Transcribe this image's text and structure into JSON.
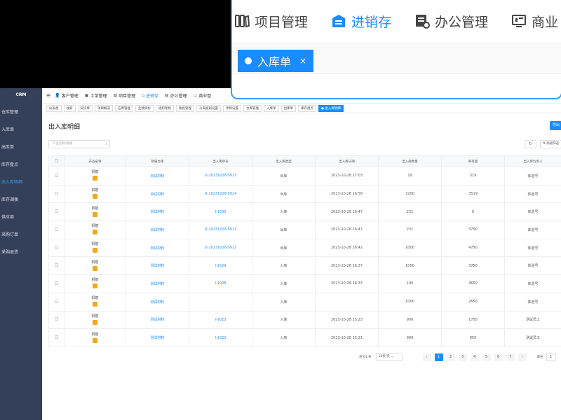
{
  "sidebar": {
    "logo": "CRM",
    "items": [
      {
        "label": "仓库管理"
      },
      {
        "label": "入库单"
      },
      {
        "label": "出库单"
      },
      {
        "label": "库存盘点"
      },
      {
        "label": "出入库明细"
      },
      {
        "label": "库存调拨"
      },
      {
        "label": "供应商"
      },
      {
        "label": "采购订单"
      },
      {
        "label": "采购退货"
      }
    ]
  },
  "navbar": {
    "items": [
      {
        "label": "客户管理"
      },
      {
        "label": "工单管理"
      },
      {
        "label": "项目管理"
      },
      {
        "label": "进销存"
      },
      {
        "label": "办公管理"
      },
      {
        "label": "商业智"
      }
    ]
  },
  "tags": [
    {
      "label": "仪表盘"
    },
    {
      "label": "线索"
    },
    {
      "label": "知识库"
    },
    {
      "label": "项目概况"
    },
    {
      "label": "应用管理"
    },
    {
      "label": "业绩目标"
    },
    {
      "label": "组织架构"
    },
    {
      "label": "角色管理"
    },
    {
      "label": "公海规则设置"
    },
    {
      "label": "项目设置"
    },
    {
      "label": "仓库管理"
    },
    {
      "label": "入库单"
    },
    {
      "label": "出库单"
    },
    {
      "label": "库存盘点"
    },
    {
      "label": "● 出入库明细"
    }
  ],
  "page": {
    "title": "出入库明细",
    "export_label": "导出"
  },
  "filters": {
    "search_placeholder": "产品名称/规格",
    "advanced_label": "高级筛选"
  },
  "table": {
    "columns": [
      "",
      "产品名称",
      "所属仓库",
      "出入库单号",
      "出入库类型",
      "出入库日期",
      "出入库数量",
      "库存量",
      "出入库负责人"
    ],
    "rows": [
      {
        "product": "钢筋",
        "warehouse": "测试材料",
        "order_no": "O-20231028-5015",
        "type": "出库",
        "date": "2023-10-28 17:03",
        "qty": "19",
        "stock": "319",
        "owner": "体验号"
      },
      {
        "product": "钢筋",
        "warehouse": "测试材料",
        "order_no": "O-20231028-5014",
        "type": "出库",
        "date": "2023-10-28 16:58",
        "qty": "3200",
        "stock": "3519",
        "owner": "体验号"
      },
      {
        "product": "钢筋",
        "warehouse": "测试材料",
        "order_no": "I-1030",
        "type": "入库",
        "date": "2023-10-28 16:47",
        "qty": "231",
        "stock": "0",
        "owner": "体验号"
      },
      {
        "product": "钢筋",
        "warehouse": "测试材料",
        "order_no": "O-20231028-5013",
        "type": "出库",
        "date": "2023-10-28 16:47",
        "qty": "231",
        "stock": "3750",
        "owner": "体验号"
      },
      {
        "product": "钢筋",
        "warehouse": "测试材料",
        "order_no": "O-20231028-5012",
        "type": "出库",
        "date": "2023-10-28 16:42",
        "qty": "1000",
        "stock": "4750",
        "owner": "体验号"
      },
      {
        "product": "钢筋",
        "warehouse": "测试材料",
        "order_no": "I-1029",
        "type": "入库",
        "date": "2023-10-28 16:37",
        "qty": "1000",
        "stock": "3750",
        "owner": "体验号"
      },
      {
        "product": "钢筋",
        "warehouse": "测试材料",
        "order_no": "I-1028",
        "type": "入库",
        "date": "2023-10-28 16:33",
        "qty": "100",
        "stock": "3650",
        "owner": "体验号"
      },
      {
        "product": "钢筋",
        "warehouse": "测试材料",
        "order_no": "",
        "type": "入库",
        "date": "",
        "qty": "1000",
        "stock": "2650",
        "owner": "体验号"
      },
      {
        "product": "钢筋",
        "warehouse": "测试材料",
        "order_no": "I-1023",
        "type": "入库",
        "date": "2023-10-28 15:23",
        "qty": "900",
        "stock": "1750",
        "owner": "测试员工"
      },
      {
        "product": "钢筋",
        "warehouse": "测试材料",
        "order_no": "I-1022",
        "type": "入库",
        "date": "2023-10-28 15:21",
        "qty": "900",
        "stock": "850",
        "owner": "测试员工"
      }
    ]
  },
  "pagination": {
    "total": "共 61 条",
    "page_size": "10条/页",
    "prev": "‹",
    "pages": [
      "1",
      "2",
      "3",
      "4",
      "5",
      "6",
      "7"
    ],
    "next": "›",
    "goto_label": "前往",
    "goto_value": "1"
  },
  "inset": {
    "nav": [
      {
        "label": "项目管理",
        "icon": "project-icon"
      },
      {
        "label": "进销存",
        "icon": "warehouse-icon"
      },
      {
        "label": "办公管理",
        "icon": "office-icon"
      },
      {
        "label": "商业",
        "icon": "bi-icon"
      }
    ],
    "tag_label": "入库单",
    "tag_close": "×"
  },
  "colors": {
    "accent": "#1a8cff",
    "sidebar": "#34405a",
    "product_badge": "#f0a81c"
  }
}
